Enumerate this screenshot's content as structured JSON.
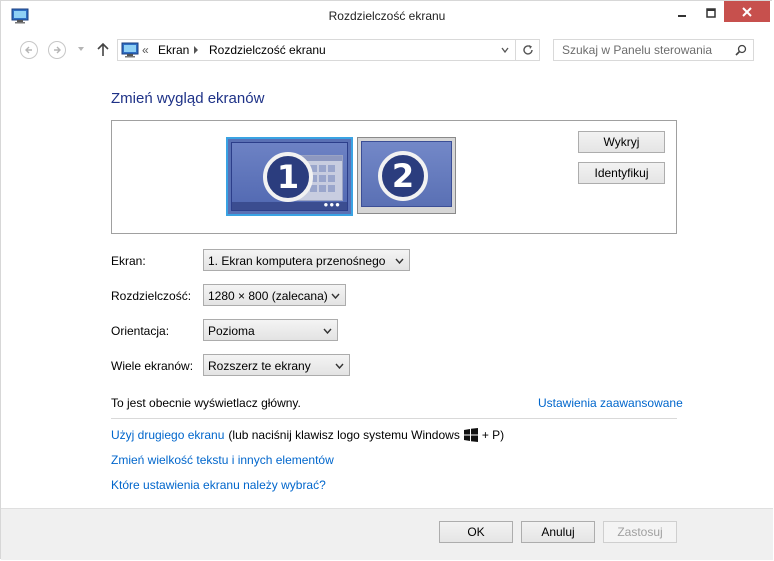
{
  "window": {
    "title": "Rozdzielczość ekranu"
  },
  "nav": {
    "breadcrumb_prefix": "«",
    "crumbs": [
      "Ekran",
      "Rozdzielczość ekranu"
    ],
    "search_placeholder": "Szukaj w Panelu sterowania"
  },
  "main": {
    "heading": "Zmień wygląd ekranów",
    "monitors": [
      {
        "number": "1",
        "selected": true
      },
      {
        "number": "2",
        "selected": false
      }
    ],
    "detect_button": "Wykryj",
    "identify_button": "Identyfikuj",
    "form": {
      "display_label": "Ekran:",
      "display_value": "1. Ekran komputera przenośnego",
      "resolution_label": "Rozdzielczość:",
      "resolution_value": "1280 × 800 (zalecana)",
      "orientation_label": "Orientacja:",
      "orientation_value": "Pozioma",
      "multiple_label": "Wiele ekranów:",
      "multiple_value": "Rozszerz te ekrany"
    },
    "primary_info": "To jest obecnie wyświetlacz główny.",
    "advanced_link": "Ustawienia zaawansowane",
    "second_screen_link": "Użyj drugiego ekranu",
    "second_screen_text": "(lub naciśnij klawisz logo systemu Windows",
    "second_screen_suffix": "+ P)",
    "text_size_link": "Zmień wielkość tekstu i innych elementów",
    "which_settings_link": "Które ustawienia ekranu należy wybrać?"
  },
  "footer": {
    "ok": "OK",
    "cancel": "Anuluj",
    "apply": "Zastosuj"
  },
  "colors": {
    "heading": "#1e3287",
    "link": "#0066cc",
    "close_button": "#c7504d",
    "monitor_selected_border": "#3aa3e3"
  }
}
